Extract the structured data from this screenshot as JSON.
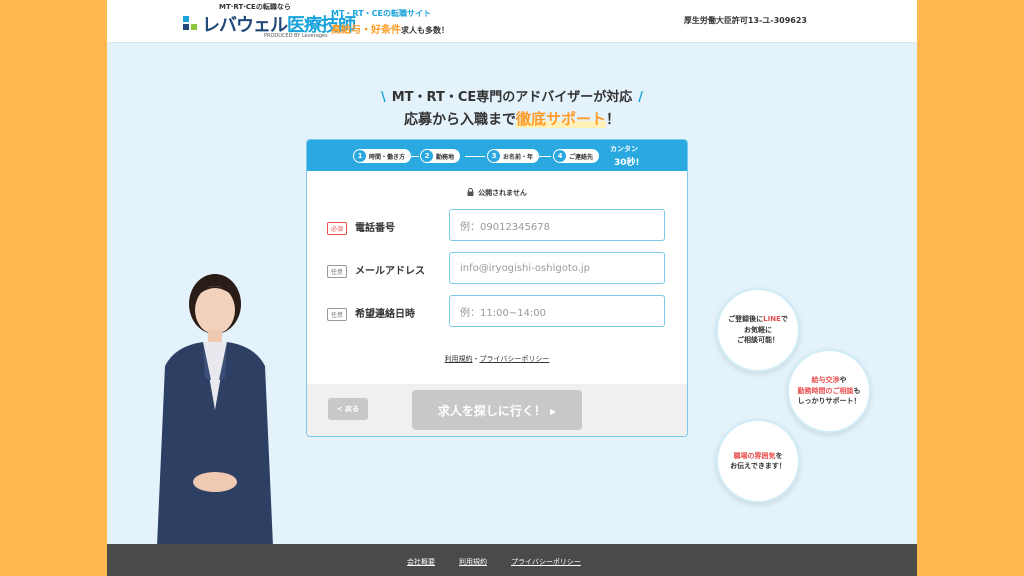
{
  "header": {
    "logo_small": "MT·RT·CEの転職なら",
    "logo_main_1": "レバウェル",
    "logo_main_2": "医療技師",
    "logo_sub": "PRODUCED BY Leverages",
    "tagline_1": "MT・RT・CEの転職サイト",
    "tagline_2a": "高給与・好条件",
    "tagline_2b": "求人も多数！",
    "license": "厚生労働大臣許可13-ユ-309623"
  },
  "hero": {
    "title_1": "MT・RT・CE専門のアドバイザーが対応",
    "title_2a": "応募から入職まで",
    "title_2b": "徹底サポート",
    "title_2c": "！"
  },
  "form": {
    "steps": [
      {
        "num": "1",
        "label": "時間・働き方"
      },
      {
        "num": "2",
        "label": "勤務地"
      },
      {
        "num": "3",
        "label": "お名前・年"
      },
      {
        "num": "4",
        "label": "ご連絡先"
      }
    ],
    "seconds_small": "カンタン",
    "seconds_big": "30秒!",
    "private_note": "公開されません",
    "fields": [
      {
        "badge": "必須",
        "label": "電話番号",
        "placeholder": "例：09012345678"
      },
      {
        "badge": "任意",
        "label": "メールアドレス",
        "placeholder": "info@iryogishi-oshigoto.jp"
      },
      {
        "badge": "任意",
        "label": "希望連絡日時",
        "placeholder": "例：11:00~14:00"
      }
    ],
    "terms_link": "利用規約",
    "sep": "・",
    "privacy_link": "プライバシーポリシー",
    "back_label": "< 戻る",
    "submit_label": "求人を探しに行く！ ▸"
  },
  "bubbles": [
    {
      "lines": [
        [
          "ご登録後に",
          "LINE",
          "で"
        ],
        [
          "お気軽に",
          "",
          ""
        ],
        [
          "ご相談可能！",
          "",
          ""
        ]
      ]
    },
    {
      "lines": [
        [
          "",
          "給与交渉",
          "や"
        ],
        [
          "",
          "勤務時間のご相談",
          "も"
        ],
        [
          "しっかりサポート！",
          "",
          ""
        ]
      ]
    },
    {
      "lines": [
        [
          "",
          "職場の雰囲気",
          "を"
        ],
        [
          "お伝えできます！",
          "",
          ""
        ]
      ]
    }
  ],
  "footer": {
    "company": "会社概要",
    "terms": "利用規約",
    "privacy": "プライバシーポリシー"
  },
  "colors": {
    "primary": "#2aa8e0",
    "accent": "#ff9b28",
    "outer_bg": "#ffb84d",
    "page_bg": "#e4f3fb",
    "required": "#e94f4f"
  }
}
